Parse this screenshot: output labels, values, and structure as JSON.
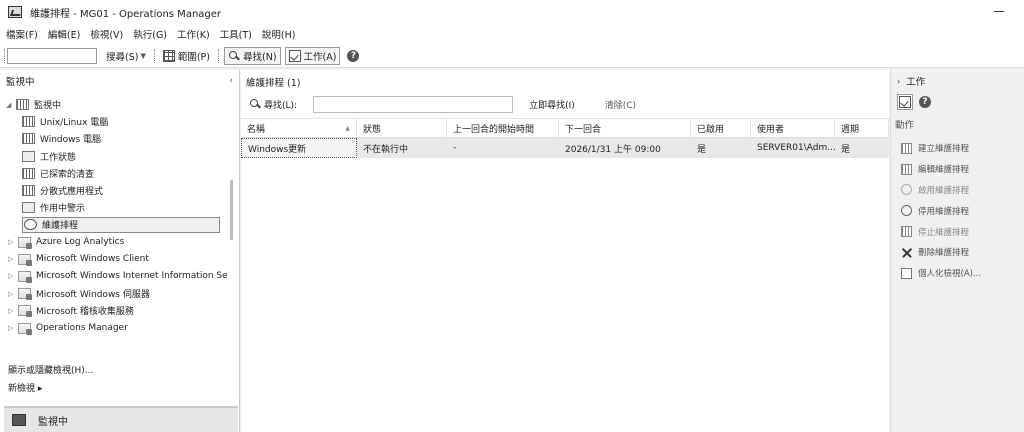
{
  "window": {
    "title": "維護排程 - MG01 - Operations Manager"
  },
  "menu": [
    "檔案(F)",
    "編輯(E)",
    "檢視(V)",
    "執行(G)",
    "工作(K)",
    "工具(T)",
    "說明(H)"
  ],
  "toolbar": {
    "search_label": "搜尋(S)",
    "scope_label": "範圍(P)",
    "find_label": "尋找(N)",
    "tasks_label": "工作(A)"
  },
  "left": {
    "header": "監視中",
    "collapse_glyph": "‹",
    "root": "監視中",
    "items": [
      "Unix/Linux 電腦",
      "Windows 電腦",
      "工作狀態",
      "已探索的清查",
      "分散式應用程式",
      "作用中警示",
      "維護排程"
    ],
    "folders": [
      "Azure Log Analytics",
      "Microsoft Windows Client",
      "Microsoft Windows Internet Information Se",
      "Microsoft Windows 伺服器",
      "Microsoft 稽核收集服務",
      "Operations Manager"
    ],
    "show_hide": "顯示或隱藏檢視(H)...",
    "new_view": "新檢視 ▸",
    "wunderbar": "監視中"
  },
  "center": {
    "title": "維護排程 (1)",
    "find_label": "尋找(L):",
    "find_value": "",
    "find_now": "立即尋找(I)",
    "clear": "清除(C)",
    "columns": [
      "名稱",
      "狀態",
      "上一回合的開始時間",
      "下一回合",
      "已啟用",
      "使用者",
      "週期"
    ],
    "rows": [
      [
        "Windows更新",
        "不在執行中",
        "-",
        "2026/1/31 上午 09:00",
        "是",
        "SERVER01\\Adm...",
        "是"
      ]
    ]
  },
  "right": {
    "header": "工作",
    "section": "動作",
    "actions": [
      "建立維護排程",
      "編輯維護排程",
      "啟用維護排程",
      "停用維護排程",
      "停止維護排程",
      "刪除維護排程",
      "個人化檢視(A)..."
    ]
  }
}
